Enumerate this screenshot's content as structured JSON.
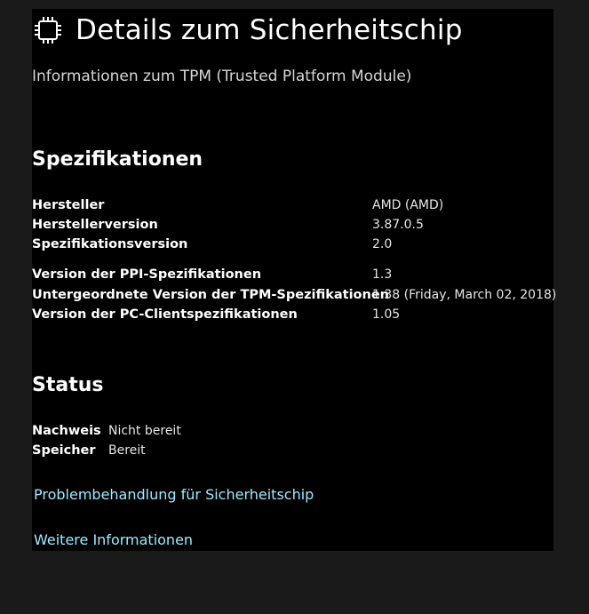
{
  "header": {
    "icon": "chip-icon",
    "title": "Details zum Sicherheitschip",
    "subtitle": "Informationen zum TPM (Trusted Platform Module)"
  },
  "specs": {
    "heading": "Spezifikationen",
    "rows": [
      {
        "label": "Hersteller",
        "value": "AMD (AMD)"
      },
      {
        "label": "Herstellerversion",
        "value": "3.87.0.5"
      },
      {
        "label": "Spezifikationsversion",
        "value": "2.0"
      },
      {
        "label": "Version der PPI-Spezifikationen",
        "value": "1.3"
      },
      {
        "label": "Untergeordnete Version der TPM-Spezifikationen",
        "value": "1.38 (Friday, March 02, 2018)"
      },
      {
        "label": "Version der PC-Clientspezifikationen",
        "value": "1.05"
      }
    ]
  },
  "status": {
    "heading": "Status",
    "rows": [
      {
        "label": "Nachweis",
        "value": "Nicht bereit"
      },
      {
        "label": "Speicher",
        "value": "Bereit"
      }
    ]
  },
  "links": {
    "troubleshoot": "Problembehandlung für Sicherheitschip",
    "more_info": "Weitere Informationen"
  },
  "colors": {
    "background": "#000000",
    "outer_background": "#1a1a1a",
    "link": "#99ebff",
    "text": "#ffffff"
  }
}
